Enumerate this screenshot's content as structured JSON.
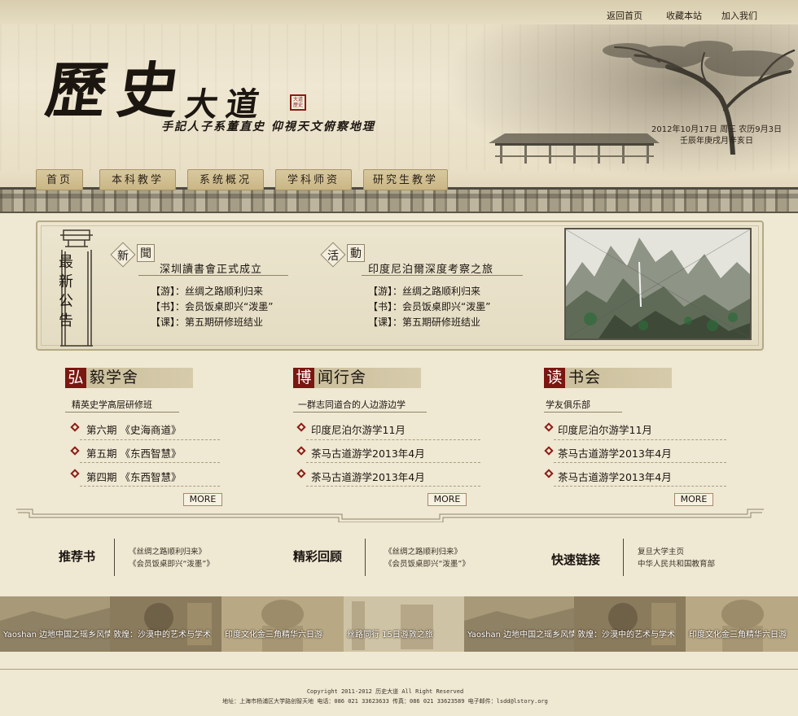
{
  "top_links": [
    "返回首页",
    "收藏本站",
    "加入我们"
  ],
  "logo": {
    "main": "歷史",
    "small": "大道",
    "seal": "大道歷史"
  },
  "slogan": "手記人子系董直史 仰視天文俯察地理",
  "date": {
    "line1": "2012年10月17日 周三 农历9月3日",
    "line2": "壬辰年庚戌月辛亥日"
  },
  "nav": [
    "首页",
    "本科教学",
    "系统概况",
    "学科师资",
    "研究生教学"
  ],
  "notice": {
    "title": "最新公告",
    "blocks": [
      {
        "label1": "新",
        "label2": "聞",
        "title": "深圳讀書會正式成立",
        "lines": [
          "【游】：丝绸之路顺利归来",
          "【书】：会员饭桌即兴“泼墨”",
          "【课】：第五期研修班结业"
        ]
      },
      {
        "label1": "活",
        "label2": "動",
        "title": "印度尼泊爾深度考察之旅",
        "lines": [
          "【游】：丝绸之路顺利归来",
          "【书】：会员饭桌即兴“泼墨”",
          "【课】：第五期研修班结业"
        ]
      }
    ]
  },
  "columns": [
    {
      "first": "弘",
      "rest": "毅学舍",
      "subtitle": "精英史学高层研修班",
      "items": [
        "第六期 《史海商道》",
        "第五期 《东西智慧》",
        "第四期 《东西智慧》"
      ],
      "more": "MORE"
    },
    {
      "first": "博",
      "rest": "闻行舍",
      "subtitle": "一群志同道合的人边游边学",
      "items": [
        "印度尼泊尔游学11月",
        "茶马古道游学2013年4月",
        "茶马古道游学2013年4月"
      ],
      "more": "MORE"
    },
    {
      "first": "读",
      "rest": "书会",
      "subtitle": "学友俱乐部",
      "items": [
        "印度尼泊尔游学11月",
        "茶马古道游学2013年4月",
        "茶马古道游学2013年4月"
      ],
      "more": "MORE"
    }
  ],
  "recommend": [
    {
      "title": "推荐书",
      "links": [
        "《丝绸之路顺利归来》",
        "《会员饭桌即兴“泼墨”》"
      ]
    },
    {
      "title": "精彩回顾",
      "links": [
        "《丝绸之路顺利归来》",
        "《会员饭桌即兴“泼墨”》"
      ]
    },
    {
      "title": "快速链接",
      "links": [
        "复旦大学主页",
        "中华人民共和国教育部"
      ]
    }
  ],
  "strip": [
    {
      "caption": "Yaoshan 边地中国之瑶乡风情",
      "color": "#a89a78"
    },
    {
      "caption": "敦煌：沙漠中的艺术与学术",
      "color": "#8b7b5d"
    },
    {
      "caption": "印度文化金三角精华六日游",
      "color": "#b8a884"
    },
    {
      "caption": "丝路同行 15日游敦之旅",
      "color": "#cfc3a5"
    },
    {
      "caption": "Yaoshan 边地中国之瑶乡风情",
      "color": "#a89a78"
    },
    {
      "caption": "敦煌：沙漠中的艺术与学术",
      "color": "#8b7b5d"
    },
    {
      "caption": "印度文化金三角精华六日游",
      "color": "#b8a884"
    }
  ],
  "footer": {
    "copyright": "Copyright 2011-2012 历史大道 All Right Reserved",
    "address": "地址：上海市杨浦区大学路创智天地 电话：086 021 33623633 传真：086 021 33623589 电子邮件：lsdd@lstory.org"
  }
}
